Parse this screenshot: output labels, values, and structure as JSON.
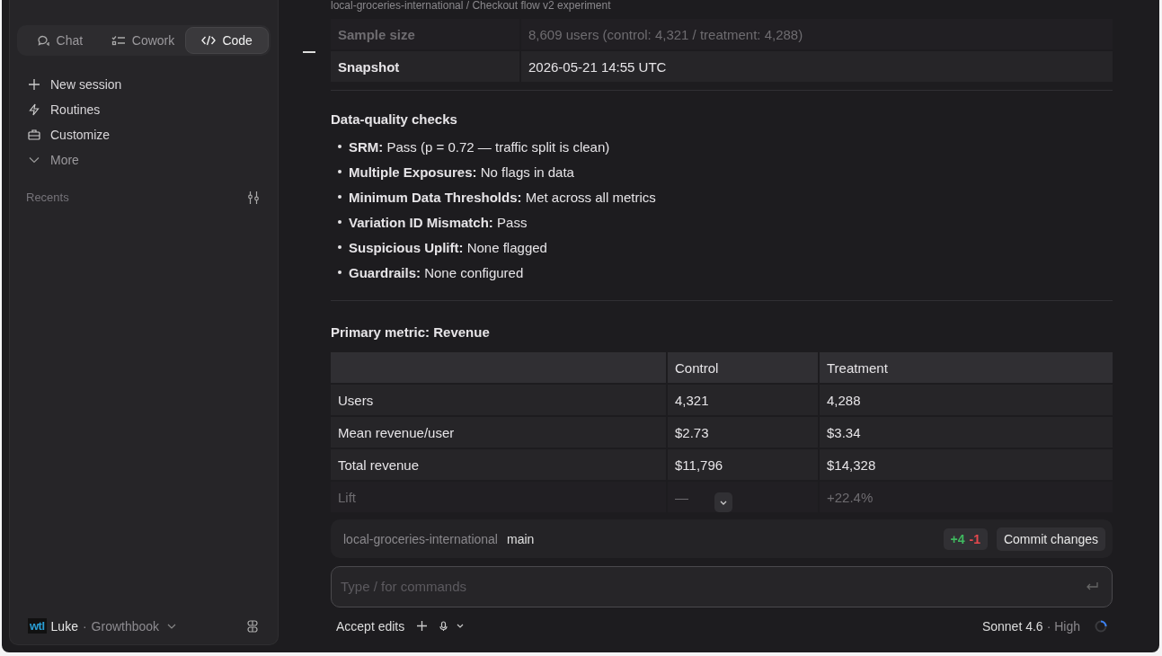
{
  "breadcrumb": "local-groceries-international / Checkout flow v2 experiment",
  "sidebar": {
    "tabs": [
      {
        "label": "Chat",
        "kind": "chat",
        "selected": false
      },
      {
        "label": "Cowork",
        "kind": "cowork",
        "selected": false
      },
      {
        "label": "Code",
        "kind": "code",
        "selected": true
      }
    ],
    "nav": [
      {
        "label": "New session",
        "kind": "plus"
      },
      {
        "label": "Routines",
        "kind": "bolt"
      },
      {
        "label": "Customize",
        "kind": "briefcase"
      },
      {
        "label": "More",
        "kind": "chevron"
      }
    ],
    "recents_label": "Recents",
    "user": {
      "logo": "wtl",
      "name": "Luke",
      "separator": "·",
      "org": "Growthbook"
    }
  },
  "summary_table": {
    "rows": [
      {
        "label": "Sample size",
        "value": "8,609 users (control: 4,321 / treatment: 4,288)",
        "faded": true
      },
      {
        "label": "Snapshot",
        "value": "2026-05-21 14:55 UTC",
        "faded": false
      }
    ]
  },
  "checks": {
    "heading": "Data-quality checks",
    "items": [
      "**SRM:** Pass (p = 0.72 — traffic split is clean)",
      "**Multiple Exposures:** No flags in data",
      "**Minimum Data Thresholds:** Met across all metrics",
      "**Variation ID Mismatch:** Pass",
      "**Suspicious Uplift:** None flagged",
      "**Guardrails:** None configured"
    ]
  },
  "metric": {
    "heading": "Primary metric: Revenue",
    "columns": [
      "",
      "Control",
      "Treatment"
    ],
    "rows": [
      {
        "cells": [
          "Users",
          "4,321",
          "4,288"
        ],
        "faded": false
      },
      {
        "cells": [
          "Mean revenue/user",
          "$2.73",
          "$3.34"
        ],
        "faded": false
      },
      {
        "cells": [
          "Total revenue",
          "$11,796",
          "$14,328"
        ],
        "faded": false
      },
      {
        "cells": [
          "Lift",
          "—",
          "+22.4%"
        ],
        "faded": true
      }
    ]
  },
  "repo_bar": {
    "repo": "local-groceries-international",
    "branch": "main",
    "added": "+4",
    "removed": "-1",
    "commit_button": "Commit changes"
  },
  "composer": {
    "placeholder": "Type / for commands"
  },
  "footer": {
    "mode": "Accept edits",
    "model": "Sonnet 4.6",
    "separator": "·",
    "effort": "High"
  }
}
